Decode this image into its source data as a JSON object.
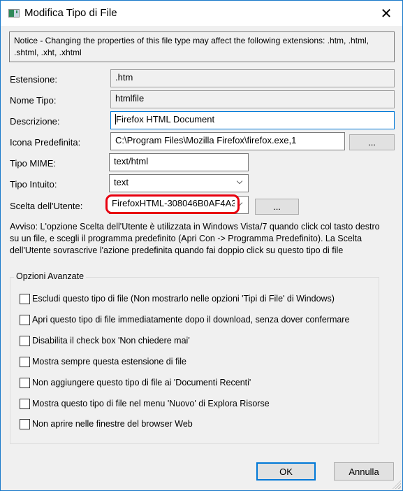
{
  "window": {
    "title": "Modifica Tipo di File",
    "icon": "app-window-icon",
    "close_icon": "close-icon"
  },
  "notice": "Notice - Changing the properties of this file type may affect the following extensions: .htm, .html, .shtml, .xht, .xhtml",
  "fields": {
    "estensione": {
      "label": "Estensione:",
      "value": ".htm"
    },
    "nome_tipo": {
      "label": "Nome Tipo:",
      "value": "htmlfile"
    },
    "descrizione": {
      "label": "Descrizione:",
      "value": "Firefox HTML Document"
    },
    "icona_predefinita": {
      "label": "Icona Predefinita:",
      "value": "C:\\Program Files\\Mozilla Firefox\\firefox.exe,1",
      "browse_label": "..."
    },
    "tipo_mime": {
      "label": "Tipo MIME:",
      "value": "text/html"
    },
    "tipo_intuito": {
      "label": "Tipo Intuito:",
      "value": "text"
    },
    "scelta_utente": {
      "label": "Scelta dell'Utente:",
      "value": "FirefoxHTML-308046B0AF4A3",
      "browse_label": "..."
    }
  },
  "highlight_color": "#e8000f",
  "avviso": "Avviso: L'opzione Scelta dell'Utente è utilizzata in Windows Vista/7 quando click col tasto destro su un file, e scegli il programma predefinito (Apri Con -> Programma Predefinito). La Scelta dell'Utente sovrascrive l'azione predefinita quando fai doppio click su questo tipo di file",
  "advanced": {
    "title": "Opzioni Avanzate",
    "options": [
      {
        "label": "Escludi questo tipo di file (Non mostrarlo nelle opzioni 'Tipi di File' di Windows)",
        "checked": false
      },
      {
        "label": "Apri questo tipo di file immediatamente dopo il download, senza dover confermare",
        "checked": false
      },
      {
        "label": "Disabilita il check box 'Non chiedere mai'",
        "checked": false
      },
      {
        "label": "Mostra sempre questa estensione di file",
        "checked": false
      },
      {
        "label": "Non aggiungere questo tipo di file ai 'Documenti Recenti'",
        "checked": false
      },
      {
        "label": "Mostra questo tipo di file nel menu 'Nuovo' di Explora Risorse",
        "checked": false
      },
      {
        "label": "Non aprire nelle finestre del browser Web",
        "checked": false
      }
    ]
  },
  "buttons": {
    "ok": "OK",
    "cancel": "Annulla"
  }
}
